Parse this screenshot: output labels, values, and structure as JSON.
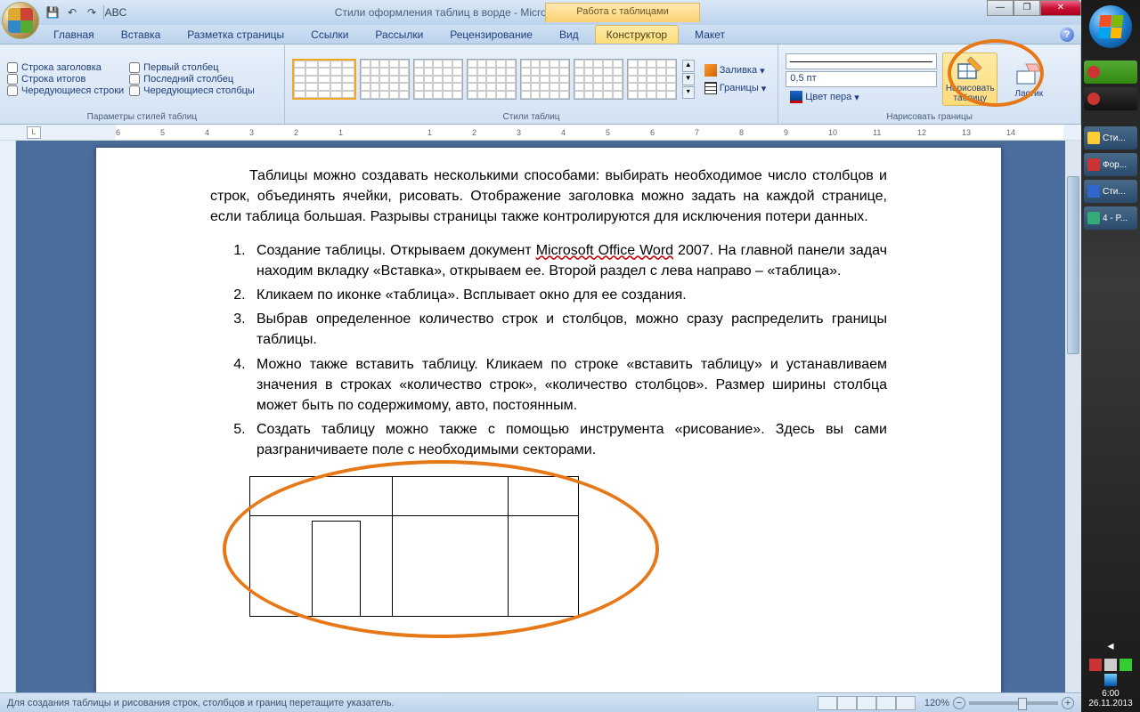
{
  "title_bar": {
    "doc_title": "Стили оформления таблиц в ворде - Microsoft Word",
    "contextual_title": "Работа с таблицами"
  },
  "qat": {
    "save": "💾",
    "undo": "↶",
    "redo": "↷",
    "spell": "✓"
  },
  "tabs": {
    "items": [
      "Главная",
      "Вставка",
      "Разметка страницы",
      "Ссылки",
      "Рассылки",
      "Рецензирование",
      "Вид",
      "Конструктор",
      "Макет"
    ],
    "active_index": 7
  },
  "ribbon": {
    "style_options": {
      "col1": [
        "Строка заголовка",
        "Строка итогов",
        "Чередующиеся строки"
      ],
      "col2": [
        "Первый столбец",
        "Последний столбец",
        "Чередующиеся столбцы"
      ],
      "group_label": "Параметры стилей таблиц"
    },
    "table_styles": {
      "group_label": "Стили таблиц",
      "shading": "Заливка",
      "borders": "Границы"
    },
    "draw_borders": {
      "pen_weight": "0,5 пт",
      "pen_color_label": "Цвет пера",
      "group_label": "Нарисовать границы",
      "draw_table": "Нарисовать таблицу",
      "eraser": "Ластик"
    }
  },
  "document": {
    "intro": "Таблицы можно создавать несколькими способами: выбирать необходимое число столбцов и строк, объединять ячейки, рисовать. Отображение заголовка можно задать на каждой странице, если таблица большая. Разрывы страницы также контролируются для исключения потери данных.",
    "list": [
      {
        "pre": "Создание таблицы. Открываем документ  ",
        "u": "Microsoft Office Word",
        "post": " 2007. На главной панели задач находим вкладку «Вставка», открываем ее.  Второй раздел с лева направо – «таблица»."
      },
      {
        "text": "Кликаем по иконке «таблица». Всплывает окно для ее создания."
      },
      {
        "text": "Выбрав определенное количество строк и столбцов, можно сразу распределить границы таблицы."
      },
      {
        "text": "Можно также вставить таблицу. Кликаем по строке «вставить таблицу» и устанавливаем значения в строках «количество строк», «количество столбцов». Размер ширины столбца может быть по содержимому, авто, постоянным."
      },
      {
        "text": "Создать таблицу можно также с помощью инструмента «рисование». Здесь вы сами разграничиваете поле с необходимыми секторами."
      }
    ]
  },
  "status": {
    "hint": "Для создания таблицы и рисования строк, столбцов и границ перетащите указатель.",
    "zoom": "120%"
  },
  "taskbar": {
    "items": [
      "Сти...",
      "Фор...",
      "Сти...",
      "4 - P..."
    ],
    "time": "6:00",
    "date": "26.11.2013"
  },
  "ruler_marks": [
    "6",
    "5",
    "4",
    "3",
    "2",
    "1",
    "",
    "1",
    "2",
    "3",
    "4",
    "5",
    "6",
    "7",
    "8",
    "9",
    "10",
    "11",
    "12",
    "13",
    "14"
  ]
}
